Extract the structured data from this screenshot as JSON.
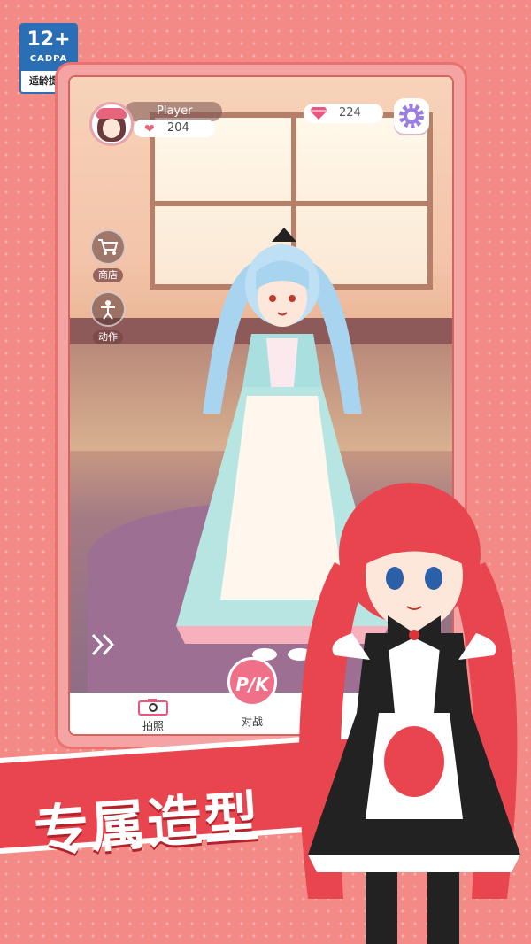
{
  "age_rating": {
    "label": "12+",
    "org": "CADPA",
    "tip": "适龄提示"
  },
  "player": {
    "name": "Player",
    "likes": "204"
  },
  "currency": {
    "gems": "224"
  },
  "side_menu": [
    {
      "label": "商店",
      "icon": "shopping-cart-icon"
    },
    {
      "label": "动作",
      "icon": "pose-figure-icon"
    }
  ],
  "bottom_bar": {
    "photo_label": "拍照",
    "battle_label": "对战",
    "battle_icon_text": "P/K"
  },
  "banner": {
    "text": "专属造型"
  },
  "colors": {
    "background": "#f48a86",
    "banner": "#e9454f",
    "pk_button": "#f0708a"
  }
}
